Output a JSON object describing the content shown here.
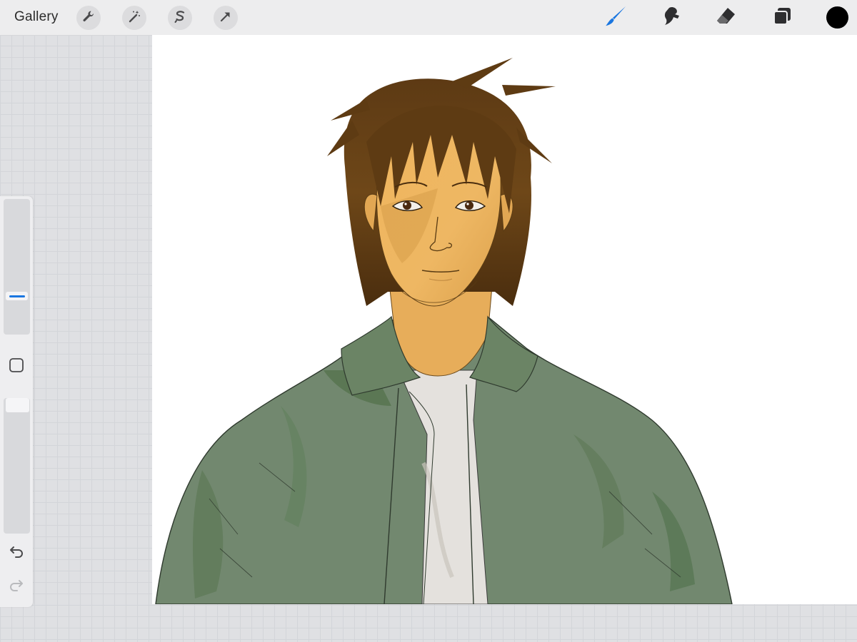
{
  "topbar": {
    "gallery_label": "Gallery",
    "left_tools": [
      "wrench-icon",
      "magic-wand-icon",
      "selection-icon",
      "transform-arrow-icon"
    ],
    "right_tools": [
      "brush-icon",
      "smudge-icon",
      "eraser-icon",
      "layers-icon",
      "color-icon"
    ],
    "active_tool": "brush",
    "accent_color": "#1a76e0",
    "current_color": "#000000"
  },
  "sidebar": {
    "brush_size_level": 0.27,
    "opacity_level": 1.0,
    "icons": [
      "modify-square-icon",
      "undo-icon",
      "redo-icon"
    ]
  },
  "canvas": {
    "background": "#ffffff",
    "content": "artwork-portrait"
  }
}
